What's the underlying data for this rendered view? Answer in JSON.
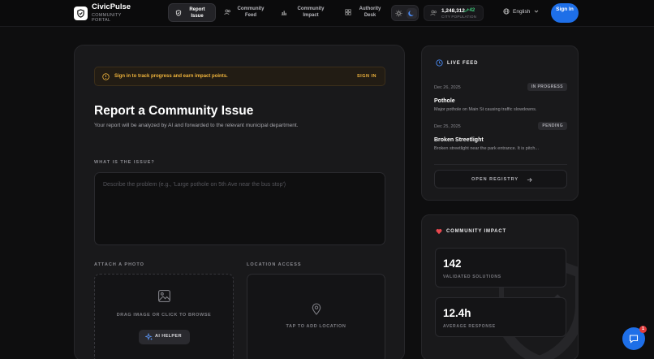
{
  "header": {
    "brand_name": "CivicPulse",
    "brand_sub": "COMMUNITY PORTAL",
    "nav": [
      {
        "label": "Report Issue",
        "icon": "shield-icon",
        "active": true
      },
      {
        "label": "Community Feed",
        "icon": "users-icon",
        "active": false
      },
      {
        "label": "Community Impact",
        "icon": "bar-chart-icon",
        "active": false
      },
      {
        "label": "Authority Desk",
        "icon": "grid-icon",
        "active": false
      }
    ],
    "population_value": "1,248,312",
    "population_delta": "+42",
    "population_label": "CITY POPULATION",
    "language": "English",
    "signin_label": "Sign In"
  },
  "notice": {
    "text": "Sign in to track progress and earn impact points.",
    "action": "SIGN IN"
  },
  "report": {
    "title": "Report a Community Issue",
    "subtitle": "Your report will be analyzed by AI and forwarded to the relevant municipal department.",
    "issue_label": "WHAT IS THE ISSUE?",
    "issue_placeholder": "Describe the problem (e.g., 'Large pothole on 5th Ave near the bus stop')",
    "photo_label": "ATTACH A PHOTO",
    "photo_hint": "DRAG IMAGE OR CLICK TO BROWSE",
    "ai_helper": "AI HELPER",
    "location_label": "LOCATION ACCESS",
    "location_hint": "TAP TO ADD LOCATION"
  },
  "live_feed": {
    "title": "LIVE FEED",
    "items": [
      {
        "date": "Dec 26, 2025",
        "status": "IN PROGRESS",
        "title": "Pothole",
        "desc": "Major pothole on Main St causing traffic slowdowns."
      },
      {
        "date": "Dec 25, 2025",
        "status": "PENDING",
        "title": "Broken Streetlight",
        "desc": "Broken streetlight near the park entrance. It is pitch..."
      }
    ],
    "registry_label": "OPEN REGISTRY"
  },
  "impact": {
    "title": "COMMUNITY IMPACT",
    "stats": [
      {
        "value": "142",
        "label": "VALIDATED SOLUTIONS"
      },
      {
        "value": "12.4h",
        "label": "AVERAGE RESPONSE"
      }
    ]
  },
  "chat": {
    "badge": "1"
  },
  "colors": {
    "accent": "#1e6fe8",
    "warning": "#f0b43c",
    "positive": "#3ec97a",
    "heart": "#e8484f"
  }
}
